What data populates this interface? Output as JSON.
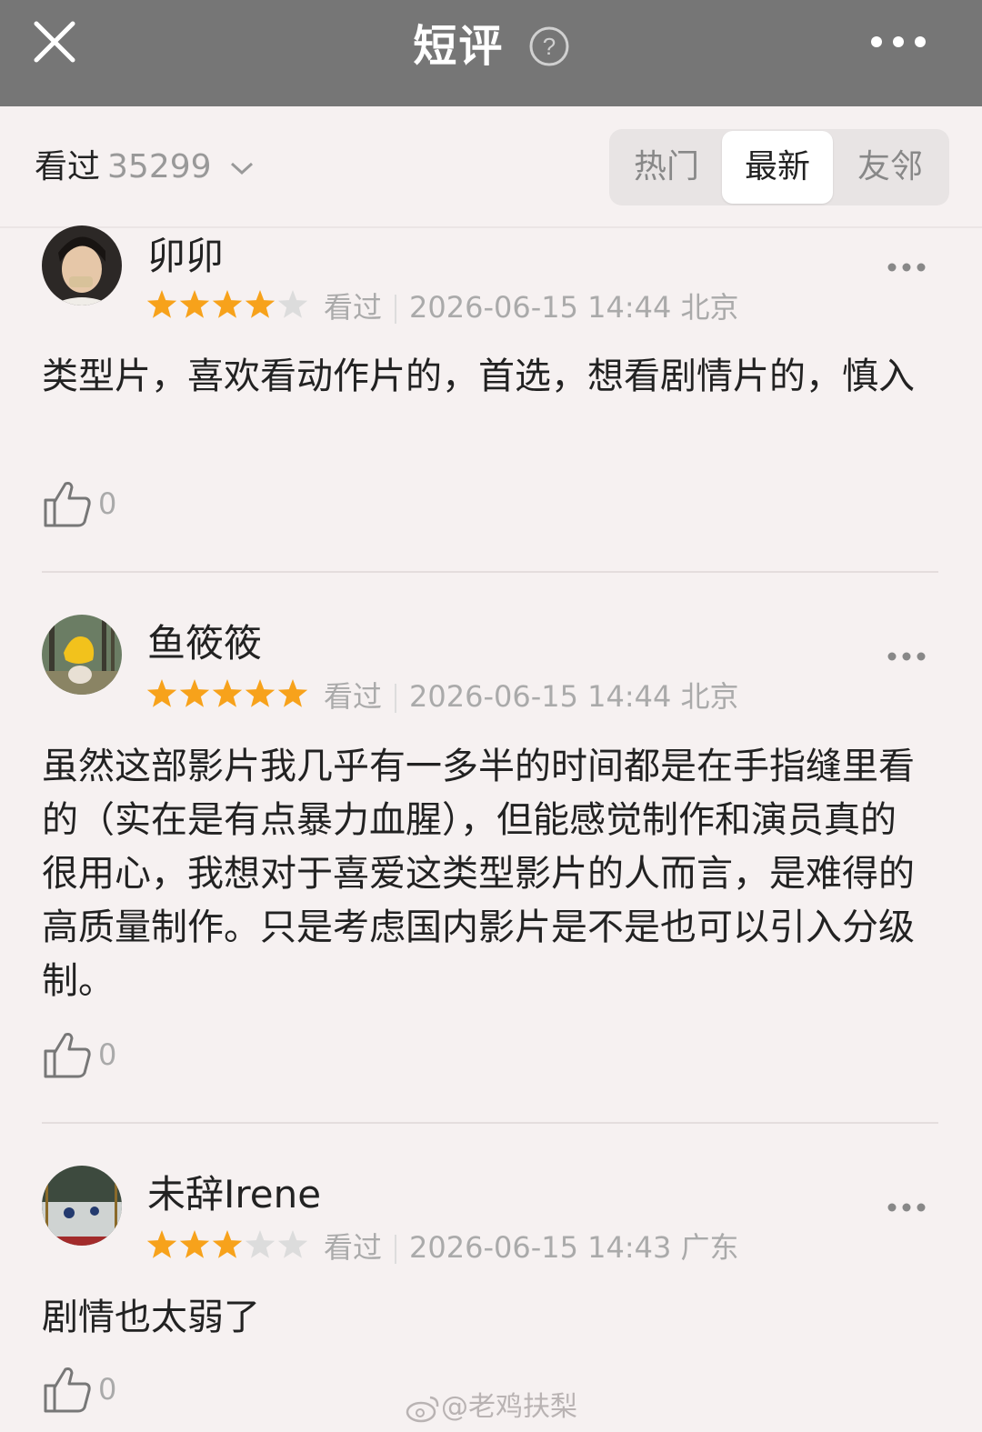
{
  "header": {
    "title": "短评"
  },
  "filter": {
    "watched_label": "看过",
    "watched_count": "35299",
    "tabs": [
      {
        "label": "热门",
        "active": false
      },
      {
        "label": "最新",
        "active": true
      },
      {
        "label": "友邻",
        "active": false
      }
    ]
  },
  "reviews": [
    {
      "username": "卯卯",
      "rating": 4,
      "status": "看过",
      "datetime": "2026-06-15 14:44",
      "location": "北京",
      "content": "类型片，喜欢看动作片的，首选，想看剧情片的，慎入",
      "likes": "0"
    },
    {
      "username": "鱼筱筱",
      "rating": 5,
      "status": "看过",
      "datetime": "2026-06-15 14:44",
      "location": "北京",
      "content": "虽然这部影片我几乎有一多半的时间都是在手指缝里看的（实在是有点暴力血腥），但能感觉制作和演员真的很用心，我想对于喜爱这类型影片的人而言，是难得的高质量制作。只是考虑国内影片是不是也可以引入分级制。",
      "likes": "0"
    },
    {
      "username": "未辞Irene",
      "rating": 3,
      "status": "看过",
      "datetime": "2026-06-15 14:43",
      "location": "广东",
      "content": "剧情也太弱了",
      "likes": "0"
    }
  ],
  "colors": {
    "star_on": "#f7a21b",
    "star_off": "#dcdcdc",
    "topbar": "#767676"
  },
  "watermark": "@老鸡扶梨"
}
